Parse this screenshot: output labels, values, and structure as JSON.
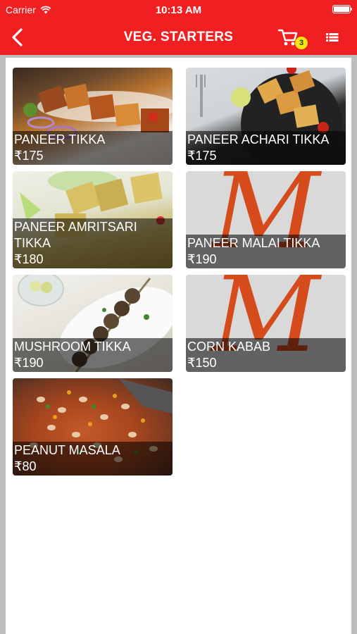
{
  "status": {
    "carrier": "Carrier",
    "time": "10:13 AM"
  },
  "header": {
    "title": "VEG. STARTERS",
    "cart_count": "3"
  },
  "items": [
    {
      "name": "PANEER TIKKA",
      "price": "₹175"
    },
    {
      "name": "PANEER ACHARI TIKKA",
      "price": "₹175"
    },
    {
      "name": "PANEER AMRITSARI TIKKA",
      "price": "₹180"
    },
    {
      "name": "PANEER MALAI TIKKA",
      "price": "₹190"
    },
    {
      "name": "MUSHROOM TIKKA",
      "price": "₹190"
    },
    {
      "name": "CORN KABAB",
      "price": "₹150"
    },
    {
      "name": "PEANUT MASALA",
      "price": "₹80"
    }
  ],
  "placeholder_logo": "M",
  "colors": {
    "header": "#f01f22",
    "badge": "#f5e614",
    "logo": "#d54b1c"
  },
  "icons": {
    "back": "back-chevron-icon",
    "cart": "cart-icon",
    "menu": "list-view-icon",
    "wifi": "wifi-icon",
    "battery": "battery-icon"
  }
}
